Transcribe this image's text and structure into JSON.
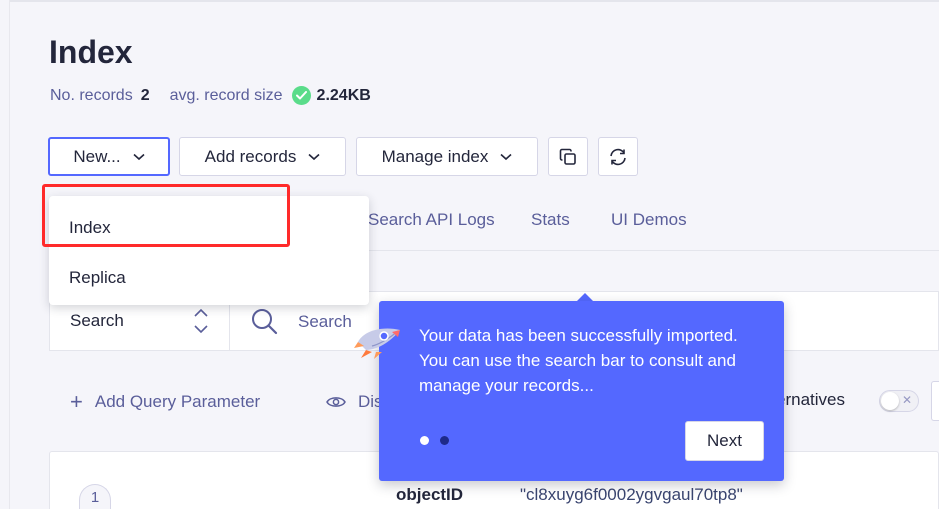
{
  "page": {
    "title": "Index"
  },
  "stats": {
    "records_label": "No. records",
    "records_value": "2",
    "avg_size_label": "avg. record size",
    "avg_size_value": "2.24KB"
  },
  "toolbar": {
    "new_label": "New...",
    "add_records_label": "Add records",
    "manage_index_label": "Manage index",
    "copy_icon": "copy-icon",
    "refresh_icon": "refresh-icon"
  },
  "new_menu": {
    "items": [
      {
        "label": "Index",
        "highlighted": true
      },
      {
        "label": "Replica",
        "highlighted": false
      }
    ]
  },
  "tabs": [
    {
      "label": "Search API Logs"
    },
    {
      "label": "Stats"
    },
    {
      "label": "UI Demos"
    }
  ],
  "search": {
    "type_select_value": "Search",
    "placeholder": "Search"
  },
  "query_tools": {
    "add_param_label": "Add Query Parameter",
    "display_partial": "Dis",
    "alternatives_partial": "ernatives"
  },
  "onboarding": {
    "message": "Your data has been successfully imported. You can use the search bar to consult and manage your records...",
    "next_label": "Next",
    "step_count": 2,
    "current_step": 1
  },
  "records": [
    {
      "index": "1",
      "attribute": "objectID",
      "value": "\"cl8xuyg6f0002ygvgaul70tp8\""
    }
  ],
  "colors": {
    "accent": "#5468ff",
    "text": "#23263b",
    "muted": "#5a5e9a",
    "success": "#5adc8a",
    "highlight": "#ff2a2a"
  }
}
